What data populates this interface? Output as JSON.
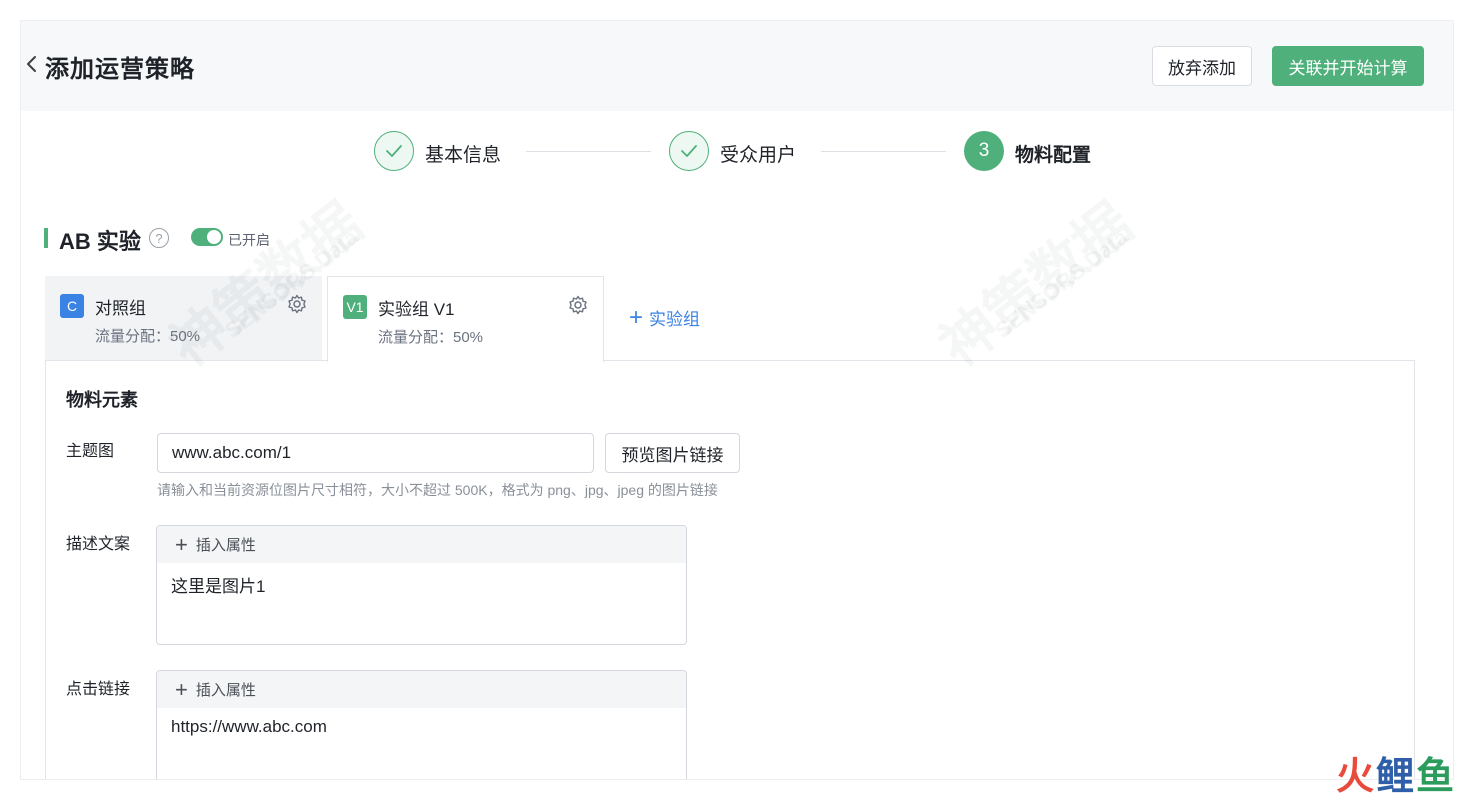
{
  "header": {
    "title": "添加运营策略",
    "cancel_label": "放弃添加",
    "primary_label": "关联并开始计算"
  },
  "steps": [
    {
      "label": "基本信息",
      "state": "done"
    },
    {
      "label": "受众用户",
      "state": "done"
    },
    {
      "label": "物料配置",
      "state": "active",
      "number": "3"
    }
  ],
  "ab": {
    "title": "AB 实验",
    "help_glyph": "?",
    "switch_label": "已开启",
    "switch_on": true
  },
  "tabs": [
    {
      "badge": "C",
      "name": "对照组",
      "traffic": "流量分配：50%",
      "badge_color": "#3a82e4"
    },
    {
      "badge": "V1",
      "name": "实验组 V1",
      "traffic": "流量分配：50%",
      "badge_color": "#4fb07b"
    }
  ],
  "add_group_label": "实验组",
  "panel": {
    "title": "物料元素",
    "theme_image": {
      "label": "主题图",
      "value": "www.abc.com/1",
      "preview_label": "预览图片链接",
      "hint": "请输入和当前资源位图片尺寸相符，大小不超过 500K，格式为 png、jpg、jpeg 的图片链接"
    },
    "description": {
      "label": "描述文案",
      "toolbar": "插入属性",
      "content": "这里是图片1"
    },
    "click_link": {
      "label": "点击链接",
      "toolbar": "插入属性",
      "content": "https://www.abc.com"
    }
  },
  "watermark": {
    "text": "神策数据",
    "subtext": "SENSORS Data"
  },
  "brand": {
    "char1": "火",
    "char2": "鲤",
    "char3": "鱼"
  },
  "colors": {
    "accent": "#4fb07b",
    "link": "#3a82e4",
    "control_badge": "#3a82e4"
  }
}
